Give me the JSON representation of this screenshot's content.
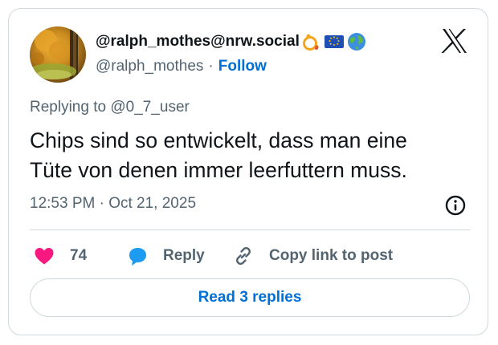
{
  "author": {
    "display_name": "@ralph_mothes@nrw.social",
    "handle": "@ralph_mothes",
    "separator": "·",
    "follow_label": "Follow",
    "badges": [
      "ring-with-sparkle-emoji",
      "eu-flag-emoji",
      "globe-emoji"
    ]
  },
  "tweet": {
    "replying_prefix": "Replying to ",
    "replying_to": "@0_7_user",
    "text": "Chips sind so entwickelt, dass man eine\nTüte von denen immer leerfuttern muss.",
    "timestamp": "12:53 PM · Oct 21, 2025"
  },
  "actions": {
    "like_count": "74",
    "reply_label": "Reply",
    "copy_label": "Copy link to post"
  },
  "footer": {
    "read_replies_label": "Read 3 replies"
  },
  "colors": {
    "like": "#f91880",
    "reply": "#1d9bf0",
    "link_blue": "#006fd6",
    "muted": "#536471",
    "border": "#cfd9de",
    "text": "#0f1419"
  },
  "icons": {
    "brand": "x-logo",
    "info": "info-icon",
    "like": "heart-icon",
    "reply": "speech-bubble-icon",
    "copy": "link-icon"
  }
}
